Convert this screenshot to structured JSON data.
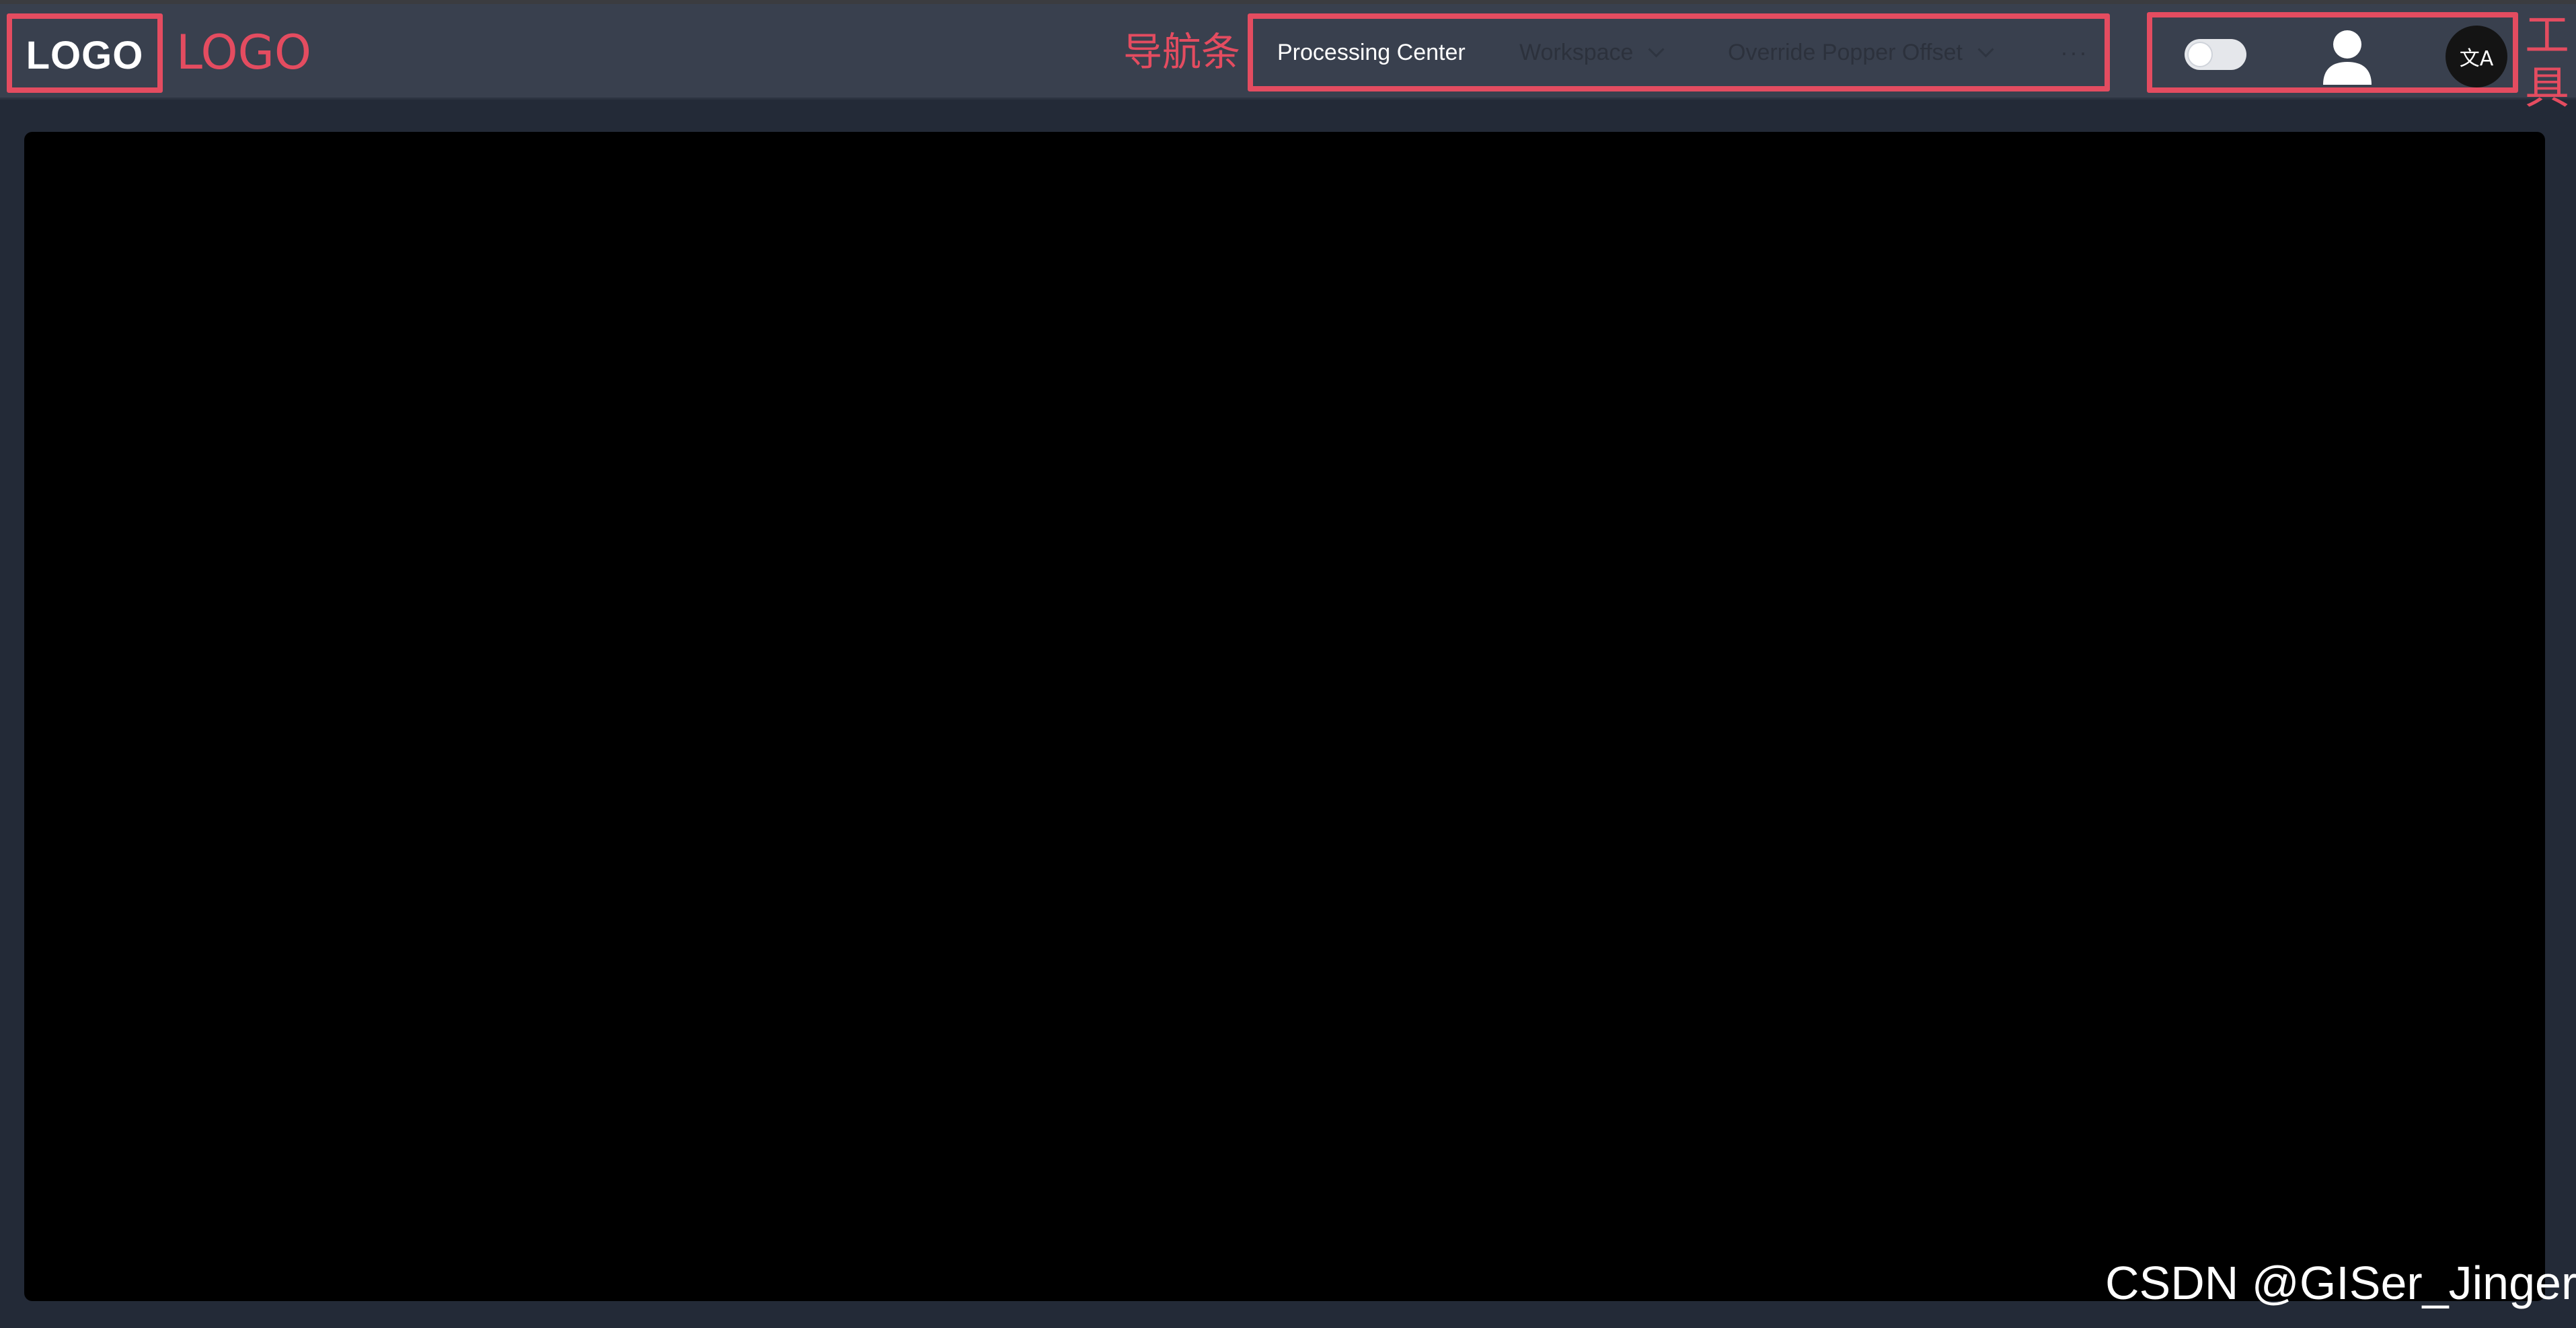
{
  "logo": {
    "text": "LOGO",
    "annotation": "LOGO"
  },
  "nav": {
    "annotation": "导航条",
    "items": [
      {
        "label": "Processing Center",
        "active": true
      },
      {
        "label": "Workspace",
        "active": false
      },
      {
        "label": "Override Popper Offset",
        "active": false
      },
      {
        "label": "···",
        "active": false
      }
    ]
  },
  "tools": {
    "annotation": "工具",
    "annotation_lines": [
      "工",
      "具"
    ],
    "theme_toggle": {
      "state": "off"
    },
    "user_icon": "user-icon",
    "translate_glyph": "文A"
  },
  "watermark": "CSDN @GISer_Jinger",
  "colors": {
    "header_bg": "#39404e",
    "page_bg": "#232a37",
    "annotation_red": "#e44c60",
    "content_bg": "#000000"
  }
}
